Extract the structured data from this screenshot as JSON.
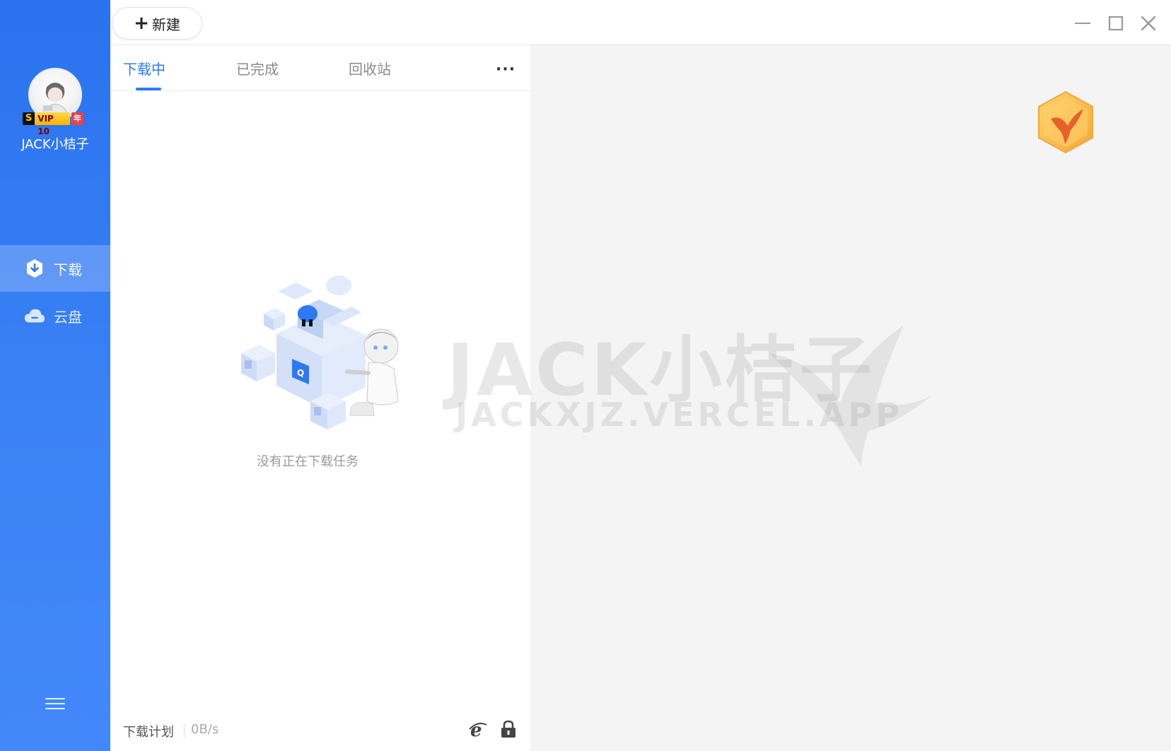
{
  "colors": {
    "sidebar": "#2f78f2",
    "accent": "#2f7bf5",
    "pane_bg": "#f4f4f4"
  },
  "sidebar": {
    "username": "JACK小桔子",
    "vip": {
      "s": "S",
      "label": "VIP 10",
      "year": "年"
    },
    "nav": [
      {
        "label": "下载",
        "icon": "download-shield-icon",
        "active": true
      },
      {
        "label": "云盘",
        "icon": "cloud-drive-icon",
        "active": false
      }
    ],
    "menu_icon": "hamburger-menu-icon"
  },
  "toolbar": {
    "new_label": "新建",
    "window_controls": [
      "minimize-icon",
      "maximize-icon",
      "close-icon"
    ]
  },
  "tabs": [
    {
      "label": "下载中",
      "active": true
    },
    {
      "label": "已完成",
      "active": false
    },
    {
      "label": "回收站",
      "active": false
    }
  ],
  "more_label": "···",
  "empty_state": {
    "text": "没有正在下载任务"
  },
  "statusbar": {
    "plan_label": "下载计划",
    "speed": "0B/s",
    "icons": [
      "ie-browser-icon",
      "lock-icon"
    ]
  },
  "watermark": {
    "main": "JACK小桔子",
    "sub": "JACKXJZ.VERCEL.APP"
  }
}
